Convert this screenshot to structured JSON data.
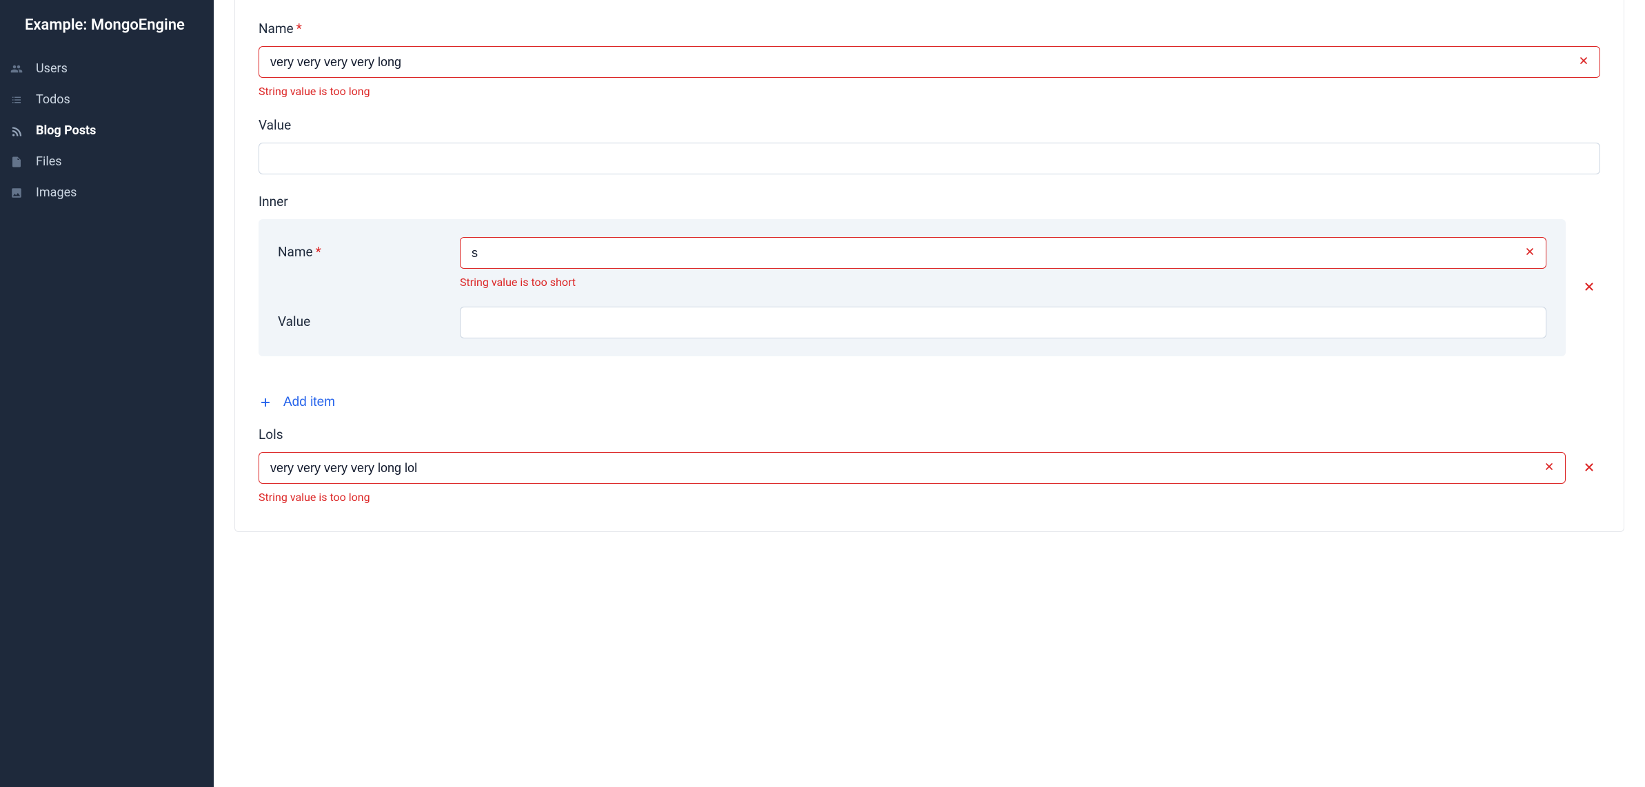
{
  "brand": "Example: MongoEngine",
  "sidebar": {
    "items": [
      {
        "label": "Users",
        "icon": "users-icon",
        "active": false
      },
      {
        "label": "Todos",
        "icon": "list-icon",
        "active": false
      },
      {
        "label": "Blog Posts",
        "icon": "rss-icon",
        "active": true
      },
      {
        "label": "Files",
        "icon": "file-icon",
        "active": false
      },
      {
        "label": "Images",
        "icon": "image-icon",
        "active": false
      }
    ]
  },
  "form": {
    "name": {
      "label": "Name",
      "required": true,
      "value": "very very very very long",
      "error": "String value is too long"
    },
    "value": {
      "label": "Value",
      "value": ""
    },
    "inner": {
      "label": "Inner",
      "name": {
        "label": "Name",
        "required": true,
        "value": "s",
        "error": "String value is too short"
      },
      "value": {
        "label": "Value",
        "value": ""
      }
    },
    "add_item_label": "Add item",
    "lols": {
      "label": "Lols",
      "value": "very very very very long lol",
      "error": "String value is too long"
    }
  },
  "colors": {
    "sidebar_bg": "#1e293b",
    "error": "#dc2626",
    "link": "#2563eb",
    "panel": "#f1f5f9"
  }
}
